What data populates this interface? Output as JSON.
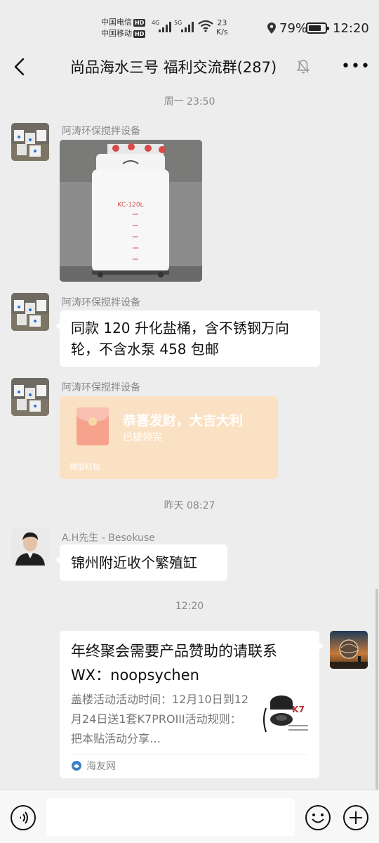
{
  "status_bar": {
    "carrier1": "中国电信",
    "carrier2": "中国移动",
    "hd": "HD",
    "net1": "4G",
    "net2": "5G",
    "speed_value": "23",
    "speed_unit": "K/s",
    "battery_percent": "79%",
    "battery_level": 0.79,
    "time": "12:20"
  },
  "header": {
    "title": "尚品海水三号 福利交流群(287)",
    "more_label": "•••"
  },
  "messages": {
    "ts1": "周一 23:50",
    "sender1": "阿涛环保搅拌设备",
    "photo_label": "KC-120L",
    "sender2": "阿涛环保搅拌设备",
    "text2": "同款 120 升化盐桶，含不锈钢万向轮，不含水泵 458 包邮",
    "sender3": "阿涛环保搅拌设备",
    "redpacket": {
      "title": "恭喜发财，大吉大利",
      "status": "已被领完",
      "footer": "微信红包"
    },
    "ts2": "昨天 08:27",
    "sender4": "A.H先生 - Besokuse",
    "text4": "锦州附近收个繁殖缸",
    "ts3": "12:20",
    "share": {
      "title": "年终聚会需要产品赞助的请联系WX：noopsychen",
      "desc": "盖楼活动活动时间：12月10日到12月24日送1套K7PROIII活动规则：把本贴活动分享…",
      "thumb_brand": "K7",
      "source": "海友网"
    }
  },
  "input": {
    "placeholder": ""
  },
  "colors": {
    "background": "#ededed",
    "bubble": "#ffffff",
    "redpacket": "#fbe1c4"
  }
}
